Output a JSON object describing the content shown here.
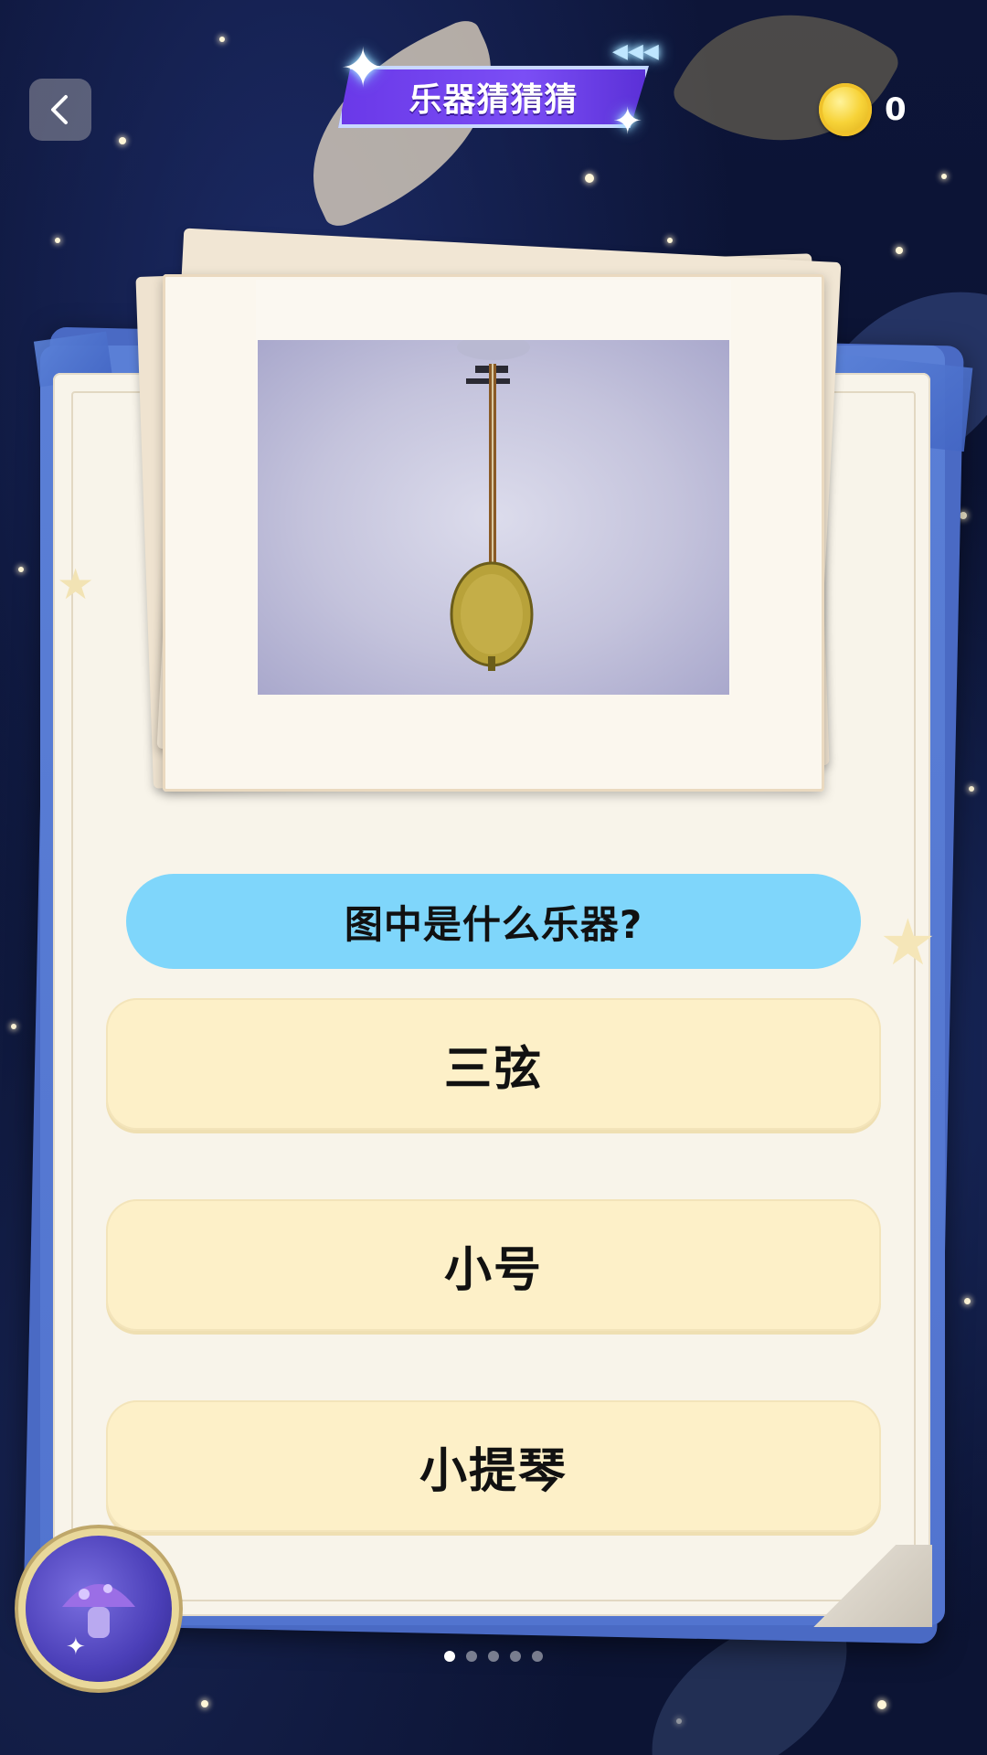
{
  "header": {
    "title": "乐器猜猜猜",
    "coin_count": "0",
    "back_icon": "chevron-left-icon",
    "coin_icon": "gold-coin-icon"
  },
  "quiz": {
    "question": "图中是什么乐器?",
    "options": [
      {
        "label": "三弦"
      },
      {
        "label": "小号"
      },
      {
        "label": "小提琴"
      }
    ],
    "image_subject": "three-string-lute-instrument"
  },
  "pager": {
    "total": 5,
    "current": 1
  },
  "colors": {
    "question_pill": "#7fd6fb",
    "option_bg": "#fdf0c8",
    "banner": "#7b4ef5",
    "book_blue": "#5274cf",
    "paper": "#f8f4ea",
    "coin": "#f7d338"
  }
}
